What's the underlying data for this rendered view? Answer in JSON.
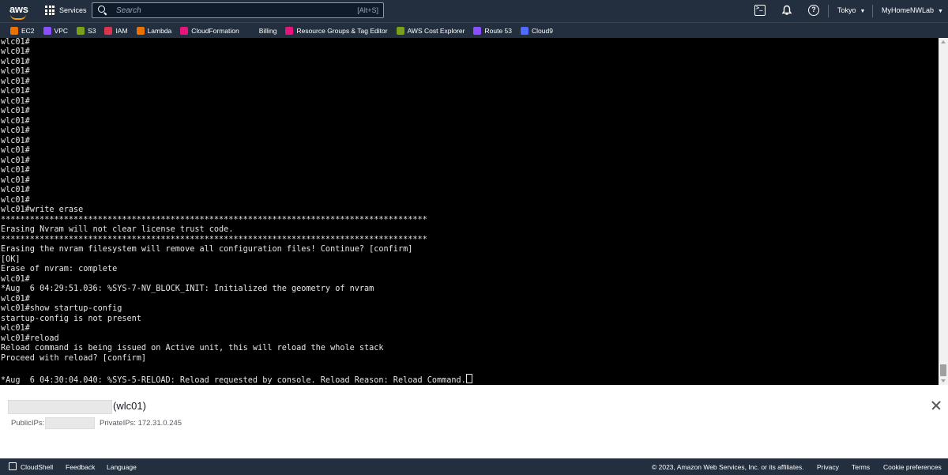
{
  "nav": {
    "logo": "aws",
    "services_label": "Services",
    "search_placeholder": "Search",
    "search_shortcut": "[Alt+S]",
    "region": "Tokyo",
    "account": "MyHomeNWLab"
  },
  "favorites": [
    {
      "label": "EC2",
      "icon": "ec2-icon",
      "color": "#ed7100"
    },
    {
      "label": "VPC",
      "icon": "vpc-icon",
      "color": "#8c4fff"
    },
    {
      "label": "S3",
      "icon": "s3-icon",
      "color": "#7aa116"
    },
    {
      "label": "IAM",
      "icon": "iam-icon",
      "color": "#dd344c"
    },
    {
      "label": "Lambda",
      "icon": "lambda-icon",
      "color": "#ed7100"
    },
    {
      "label": "CloudFormation",
      "icon": "cloudformation-icon",
      "color": "#e7157b"
    },
    {
      "label": "Billing",
      "icon": "billing-icon",
      "color": "#232f3e"
    },
    {
      "label": "Resource Groups & Tag Editor",
      "icon": "resource-groups-icon",
      "color": "#e7157b"
    },
    {
      "label": "AWS Cost Explorer",
      "icon": "cost-explorer-icon",
      "color": "#7aa116"
    },
    {
      "label": "Route 53",
      "icon": "route53-icon",
      "color": "#8c4fff"
    },
    {
      "label": "Cloud9",
      "icon": "cloud9-icon",
      "color": "#4d6bfe"
    }
  ],
  "terminal": {
    "lines": [
      "wlc01#",
      "wlc01#",
      "wlc01#",
      "wlc01#",
      "wlc01#",
      "wlc01#",
      "wlc01#",
      "wlc01#",
      "wlc01#",
      "wlc01#",
      "wlc01#",
      "wlc01#",
      "wlc01#",
      "wlc01#",
      "wlc01#",
      "wlc01#",
      "wlc01#",
      "wlc01#write erase",
      "****************************************************************************************",
      "Erasing Nvram will not clear license trust code.",
      "****************************************************************************************",
      "Erasing the nvram filesystem will remove all configuration files! Continue? [confirm]",
      "[OK]",
      "Erase of nvram: complete",
      "wlc01#",
      "*Aug  6 04:29:51.036: %SYS-7-NV_BLOCK_INIT: Initialized the geometry of nvram",
      "wlc01#",
      "wlc01#show startup-config",
      "startup-config is not present",
      "wlc01#",
      "wlc01#reload",
      "Reload command is being issued on Active unit, this will reload the whole stack",
      "Proceed with reload? [confirm]",
      "",
      "*Aug  6 04:30:04.040: %SYS-5-RELOAD: Reload requested by console. Reload Reason: Reload Command."
    ]
  },
  "instance": {
    "title": "(wlc01)",
    "public_ips_label": "PublicIPs:",
    "private_ips_text": "PrivateIPs: 172.31.0.245"
  },
  "footer": {
    "cloudshell": "CloudShell",
    "feedback": "Feedback",
    "language": "Language",
    "copyright": "© 2023, Amazon Web Services, Inc. or its affiliates.",
    "privacy": "Privacy",
    "terms": "Terms",
    "cookie": "Cookie preferences"
  }
}
